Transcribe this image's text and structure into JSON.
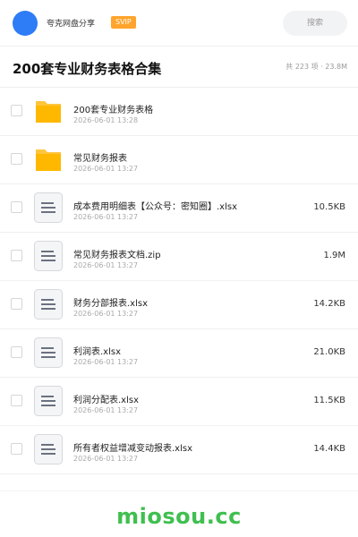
{
  "header": {
    "user_name": "夸克网盘分享",
    "badge": "SVIP",
    "search_placeholder": "搜索"
  },
  "share": {
    "title": "200套专业财务表格合集",
    "summary": "共 223 项 · 23.8M"
  },
  "files": [
    {
      "type": "folder",
      "icon": "folder-icon",
      "name": "200套专业财务表格",
      "date": "2026-06-01 13:28",
      "size": ""
    },
    {
      "type": "folder",
      "icon": "folder-icon",
      "name": "常见财务报表",
      "date": "2026-06-01 13:27",
      "size": ""
    },
    {
      "type": "file",
      "icon": "document-icon",
      "name": "成本费用明细表【公众号：密知圈】.xlsx",
      "date": "2026-06-01 13:27",
      "size": "10.5KB"
    },
    {
      "type": "file",
      "icon": "document-icon",
      "name": "常见财务报表文档.zip",
      "date": "2026-06-01 13:27",
      "size": "1.9M"
    },
    {
      "type": "file",
      "icon": "document-icon",
      "name": "财务分部报表.xlsx",
      "date": "2026-06-01 13:27",
      "size": "14.2KB"
    },
    {
      "type": "file",
      "icon": "document-icon",
      "name": "利润表.xlsx",
      "date": "2026-06-01 13:27",
      "size": "21.0KB"
    },
    {
      "type": "file",
      "icon": "document-icon",
      "name": "利润分配表.xlsx",
      "date": "2026-06-01 13:27",
      "size": "11.5KB"
    },
    {
      "type": "file",
      "icon": "document-icon",
      "name": "所有者权益增减变动报表.xlsx",
      "date": "2026-06-01 13:27",
      "size": "14.4KB"
    }
  ],
  "footer": {
    "brand": "miosou.cc"
  },
  "colors": {
    "avatar": "#2e7cf6",
    "svip": "#ffa42c",
    "folder": "#ffc53d",
    "brand": "#3fbf4f"
  }
}
